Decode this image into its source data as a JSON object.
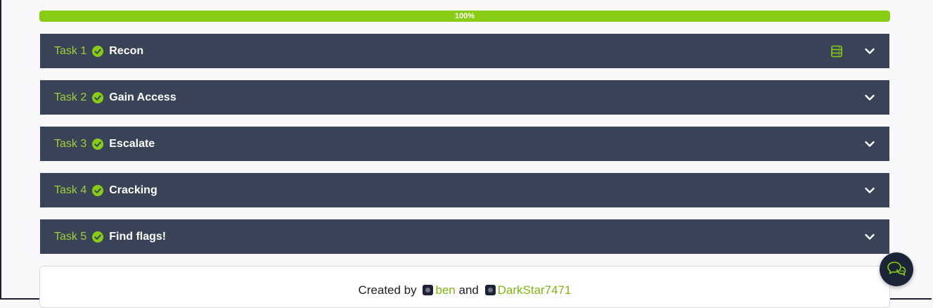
{
  "progress": {
    "value": 100,
    "label": "100%"
  },
  "tasks": [
    {
      "number": "Task 1",
      "title": "Recon",
      "completed": true,
      "has_machine": true
    },
    {
      "number": "Task 2",
      "title": "Gain Access",
      "completed": true,
      "has_machine": false
    },
    {
      "number": "Task 3",
      "title": "Escalate",
      "completed": true,
      "has_machine": false
    },
    {
      "number": "Task 4",
      "title": "Cracking",
      "completed": true,
      "has_machine": false
    },
    {
      "number": "Task 5",
      "title": "Find flags!",
      "completed": true,
      "has_machine": false
    }
  ],
  "credits": {
    "prefix": "Created by",
    "conjunction": "and",
    "authors": [
      "ben",
      "DarkStar7471"
    ]
  },
  "icons": {
    "check": "check-circle-icon",
    "machine": "server-icon",
    "chevron": "chevron-down-icon",
    "chat": "chat-bubbles-icon"
  },
  "colors": {
    "accent": "#88cc14",
    "task_bg": "#394357",
    "task_number": "#9fd037",
    "chat_bg": "#1c2538"
  }
}
